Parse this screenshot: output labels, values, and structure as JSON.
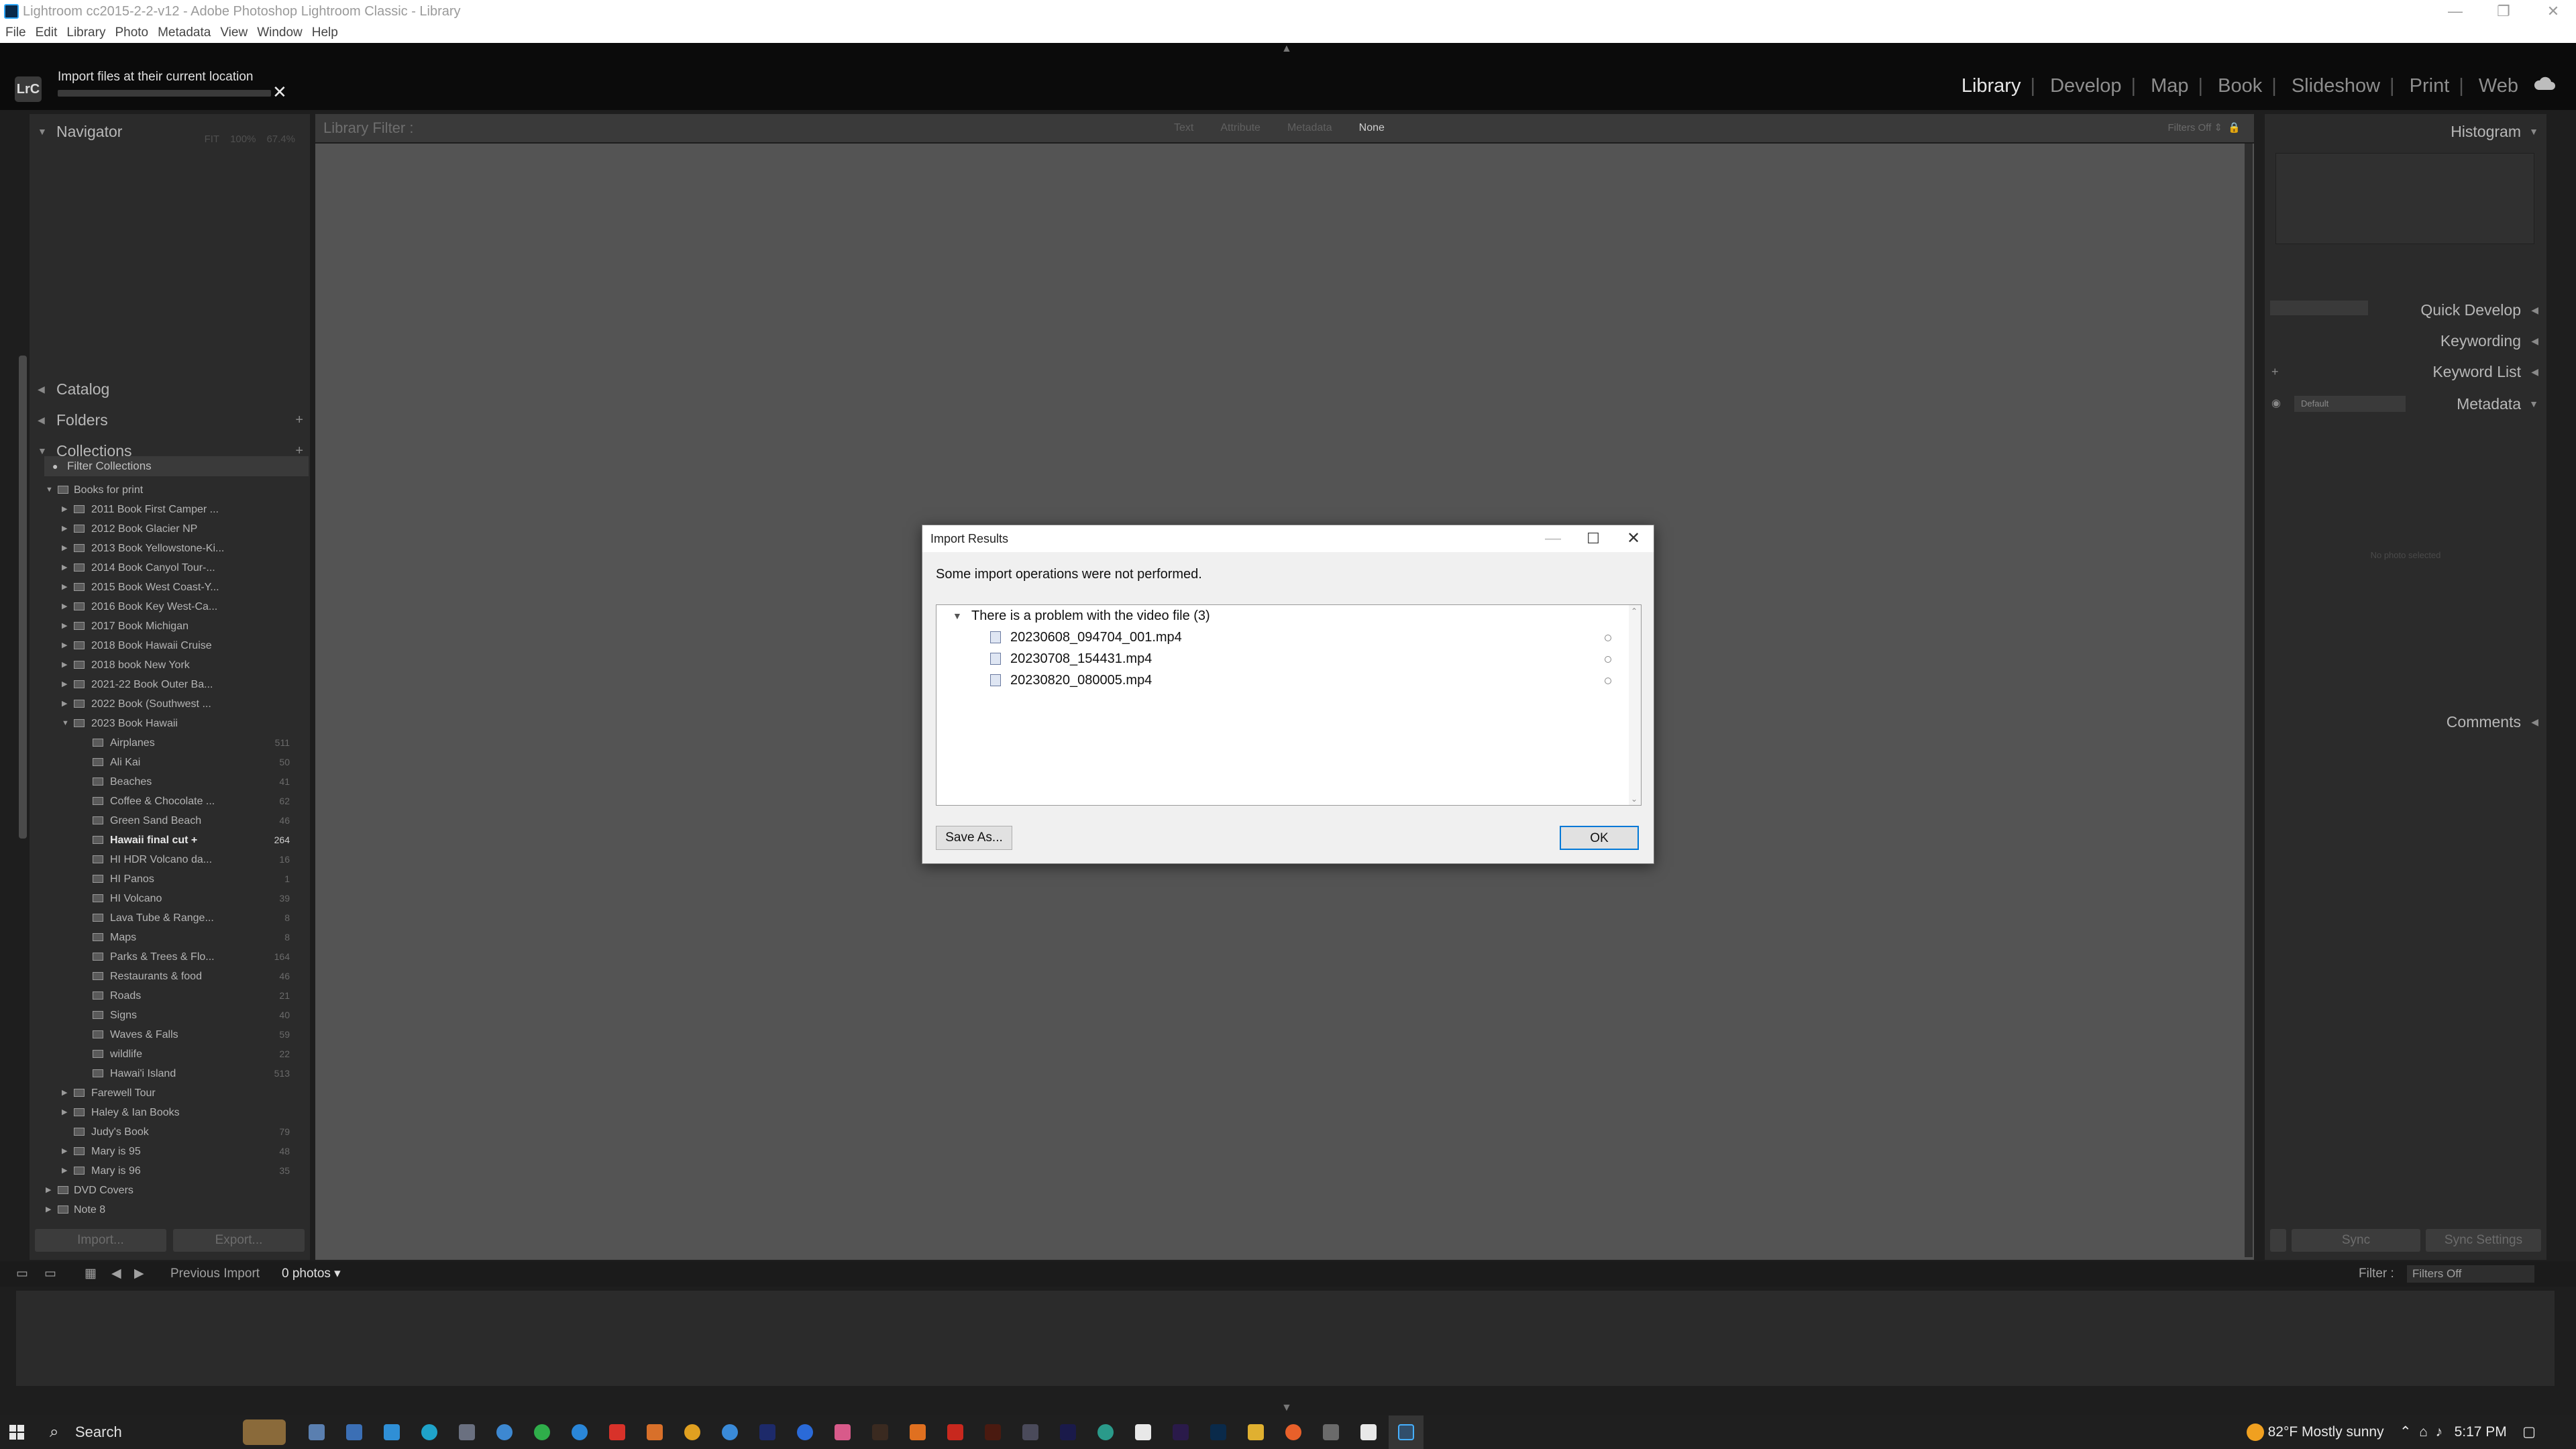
{
  "window": {
    "title": "Lightroom cc2015-2-2-v12 - Adobe Photoshop Lightroom Classic - Library",
    "minimize": "—",
    "maximize": "❐",
    "close": "✕"
  },
  "menu": [
    "File",
    "Edit",
    "Library",
    "Photo",
    "Metadata",
    "View",
    "Window",
    "Help"
  ],
  "identity": {
    "logo": "LrC",
    "import_status": "Import files at their current location",
    "progress": 0.0
  },
  "modules": [
    "Library",
    "Develop",
    "Map",
    "Book",
    "Slideshow",
    "Print",
    "Web"
  ],
  "active_module": "Library",
  "left_panel": {
    "navigator": {
      "label": "Navigator",
      "zoom": [
        "FIT",
        "100%",
        "67.4%"
      ]
    },
    "catalog": "Catalog",
    "folders": "Folders",
    "collections": "Collections",
    "filter_collections": "Filter Collections",
    "tree": [
      {
        "label": "Books for print",
        "level": 1,
        "tri": "▼",
        "count": ""
      },
      {
        "label": "2011 Book First Camper ...",
        "level": 2,
        "tri": "▶",
        "count": ""
      },
      {
        "label": "2012 Book Glacier NP",
        "level": 2,
        "tri": "▶",
        "count": ""
      },
      {
        "label": "2013 Book Yellowstone-Ki...",
        "level": 2,
        "tri": "▶",
        "count": ""
      },
      {
        "label": "2014 Book Canyol Tour-...",
        "level": 2,
        "tri": "▶",
        "count": ""
      },
      {
        "label": "2015 Book West Coast-Y...",
        "level": 2,
        "tri": "▶",
        "count": ""
      },
      {
        "label": "2016 Book Key West-Ca...",
        "level": 2,
        "tri": "▶",
        "count": ""
      },
      {
        "label": "2017 Book Michigan",
        "level": 2,
        "tri": "▶",
        "count": ""
      },
      {
        "label": "2018 Book Hawaii Cruise",
        "level": 2,
        "tri": "▶",
        "count": ""
      },
      {
        "label": "2018 book New York",
        "level": 2,
        "tri": "▶",
        "count": ""
      },
      {
        "label": "2021-22 Book Outer Ba...",
        "level": 2,
        "tri": "▶",
        "count": ""
      },
      {
        "label": "2022 Book (Southwest ...",
        "level": 2,
        "tri": "▶",
        "count": ""
      },
      {
        "label": "2023 Book Hawaii",
        "level": 2,
        "tri": "▼",
        "count": ""
      },
      {
        "label": "Airplanes",
        "level": 3,
        "tri": "",
        "count": "511"
      },
      {
        "label": "Ali Kai",
        "level": 3,
        "tri": "",
        "count": "50"
      },
      {
        "label": "Beaches",
        "level": 3,
        "tri": "",
        "count": "41"
      },
      {
        "label": "Coffee & Chocolate ...",
        "level": 3,
        "tri": "",
        "count": "62"
      },
      {
        "label": "Green Sand Beach",
        "level": 3,
        "tri": "",
        "count": "46"
      },
      {
        "label": "Hawaii final cut  +",
        "level": 3,
        "tri": "",
        "count": "264",
        "highlight": true
      },
      {
        "label": "HI HDR Volcano da...",
        "level": 3,
        "tri": "",
        "count": "16"
      },
      {
        "label": "HI Panos",
        "level": 3,
        "tri": "",
        "count": "1"
      },
      {
        "label": "HI Volcano",
        "level": 3,
        "tri": "",
        "count": "39"
      },
      {
        "label": "Lava Tube & Range...",
        "level": 3,
        "tri": "",
        "count": "8"
      },
      {
        "label": "Maps",
        "level": 3,
        "tri": "",
        "count": "8"
      },
      {
        "label": "Parks & Trees & Flo...",
        "level": 3,
        "tri": "",
        "count": "164"
      },
      {
        "label": "Restaurants & food",
        "level": 3,
        "tri": "",
        "count": "46"
      },
      {
        "label": "Roads",
        "level": 3,
        "tri": "",
        "count": "21"
      },
      {
        "label": "Signs",
        "level": 3,
        "tri": "",
        "count": "40"
      },
      {
        "label": "Waves & Falls",
        "level": 3,
        "tri": "",
        "count": "59"
      },
      {
        "label": "wildlife",
        "level": 3,
        "tri": "",
        "count": "22"
      },
      {
        "label": "Hawai'i Island",
        "level": 3,
        "tri": "",
        "count": "513"
      },
      {
        "label": "Farewell Tour",
        "level": 2,
        "tri": "▶",
        "count": ""
      },
      {
        "label": "Haley & Ian Books",
        "level": 2,
        "tri": "▶",
        "count": ""
      },
      {
        "label": "Judy's Book",
        "level": 2,
        "tri": "",
        "count": "79"
      },
      {
        "label": "Mary is 95",
        "level": 2,
        "tri": "▶",
        "count": "48"
      },
      {
        "label": "Mary is 96",
        "level": 2,
        "tri": "▶",
        "count": "35"
      },
      {
        "label": "DVD Covers",
        "level": 1,
        "tri": "▶",
        "count": ""
      },
      {
        "label": "Note 8",
        "level": 1,
        "tri": "▶",
        "count": ""
      }
    ],
    "import_button": "Import...",
    "export_button": "Export..."
  },
  "filter_bar": {
    "title": "Library Filter :",
    "tabs": [
      "Text",
      "Attribute",
      "Metadata",
      "None"
    ],
    "active_tab": "None",
    "filters_off": "Filters Off"
  },
  "right_panel": {
    "histogram": "Histogram",
    "quick_develop": "Quick Develop",
    "keywording": "Keywording",
    "keyword_list": "Keyword List",
    "metadata": "Metadata",
    "metadata_preset": "Default",
    "no_photo": "No photo selected",
    "comments": "Comments",
    "sync": "Sync",
    "sync_settings": "Sync Settings"
  },
  "strip_bar": {
    "source": "Previous Import",
    "count": "0 photos",
    "filter_label": "Filter :",
    "filter_value": "Filters Off"
  },
  "dialog": {
    "title": "Import Results",
    "message": "Some import operations were not performed.",
    "group": "There is a problem with the video file (3)",
    "files": [
      "20230608_094704_001.mp4",
      "20230708_154431.mp4",
      "20230820_080005.mp4"
    ],
    "save_as": "Save As...",
    "ok": "OK"
  },
  "taskbar": {
    "search": "Search",
    "weather": "82°F  Mostly sunny",
    "time": "5:17 PM"
  }
}
